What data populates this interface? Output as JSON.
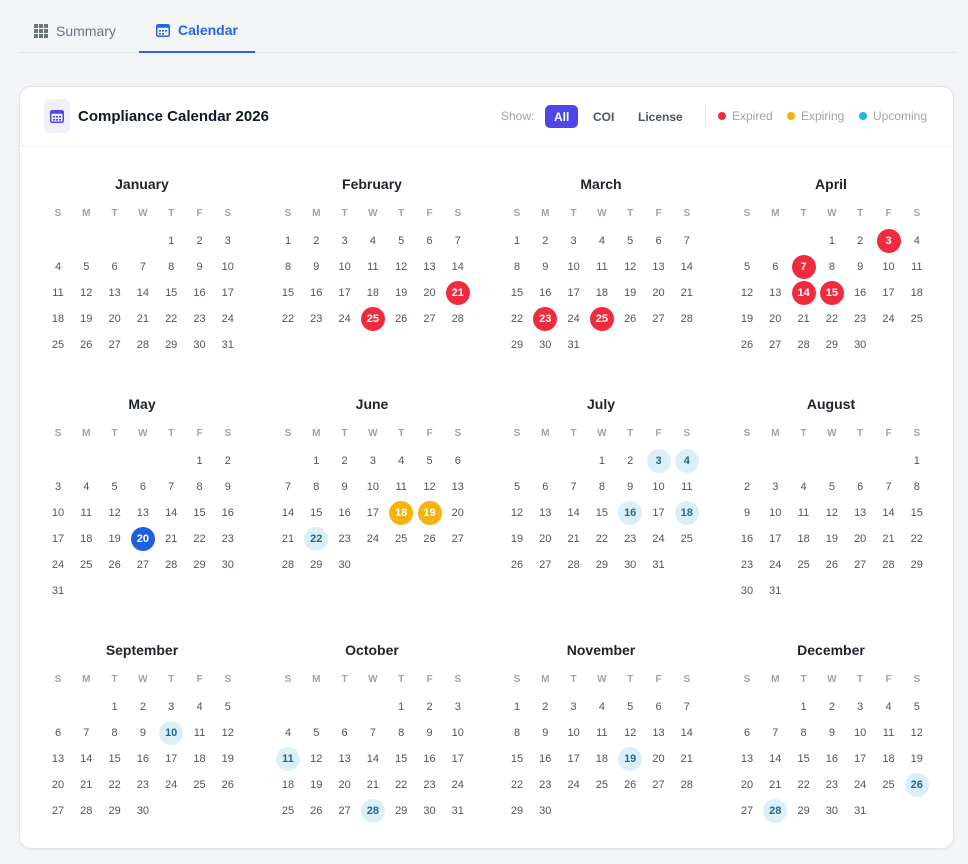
{
  "tabs": [
    {
      "label": "Summary",
      "icon": "grid-icon",
      "active": false
    },
    {
      "label": "Calendar",
      "icon": "calendar-icon",
      "active": true
    }
  ],
  "header": {
    "title": "Compliance Calendar 2026",
    "icon": "calendar-icon",
    "show_label": "Show:",
    "filters": [
      {
        "label": "All",
        "active": true
      },
      {
        "label": "COI",
        "active": false
      },
      {
        "label": "License",
        "active": false
      }
    ],
    "legend": [
      {
        "label": "Expired",
        "color": "#ef2b3d"
      },
      {
        "label": "Expiring",
        "color": "#f6b10a"
      },
      {
        "label": "Upcoming",
        "color": "#1eb6e6"
      }
    ]
  },
  "colors": {
    "accent": "#4f46e5",
    "tab_active": "#2563eb",
    "expired": "#ef2b3d",
    "expiring": "#f6b10a",
    "upcoming_bg": "#dbeff8",
    "today": "#1d5fe0"
  },
  "weekday_labels": [
    "S",
    "M",
    "T",
    "W",
    "T",
    "F",
    "S"
  ],
  "months": [
    {
      "name": "January",
      "first_weekday": 4,
      "days": 31,
      "marks": {}
    },
    {
      "name": "February",
      "first_weekday": 0,
      "days": 28,
      "marks": {
        "21": "expired",
        "25": "expired"
      }
    },
    {
      "name": "March",
      "first_weekday": 0,
      "days": 31,
      "marks": {
        "23": "expired",
        "25": "expired"
      }
    },
    {
      "name": "April",
      "first_weekday": 3,
      "days": 30,
      "marks": {
        "3": "expired",
        "7": "expired",
        "14": "expired",
        "15": "expired"
      }
    },
    {
      "name": "May",
      "first_weekday": 5,
      "days": 31,
      "marks": {
        "20": "today"
      }
    },
    {
      "name": "June",
      "first_weekday": 1,
      "days": 30,
      "marks": {
        "18": "expiring",
        "19": "expiring",
        "22": "upcoming"
      }
    },
    {
      "name": "July",
      "first_weekday": 3,
      "days": 31,
      "marks": {
        "3": "upcoming",
        "4": "upcoming",
        "16": "upcoming",
        "18": "upcoming"
      }
    },
    {
      "name": "August",
      "first_weekday": 6,
      "days": 31,
      "marks": {}
    },
    {
      "name": "September",
      "first_weekday": 2,
      "days": 30,
      "marks": {
        "10": "upcoming"
      }
    },
    {
      "name": "October",
      "first_weekday": 4,
      "days": 31,
      "marks": {
        "11": "upcoming",
        "28": "upcoming"
      }
    },
    {
      "name": "November",
      "first_weekday": 0,
      "days": 30,
      "marks": {
        "19": "upcoming"
      }
    },
    {
      "name": "December",
      "first_weekday": 2,
      "days": 31,
      "marks": {
        "26": "upcoming",
        "28": "upcoming"
      }
    }
  ]
}
